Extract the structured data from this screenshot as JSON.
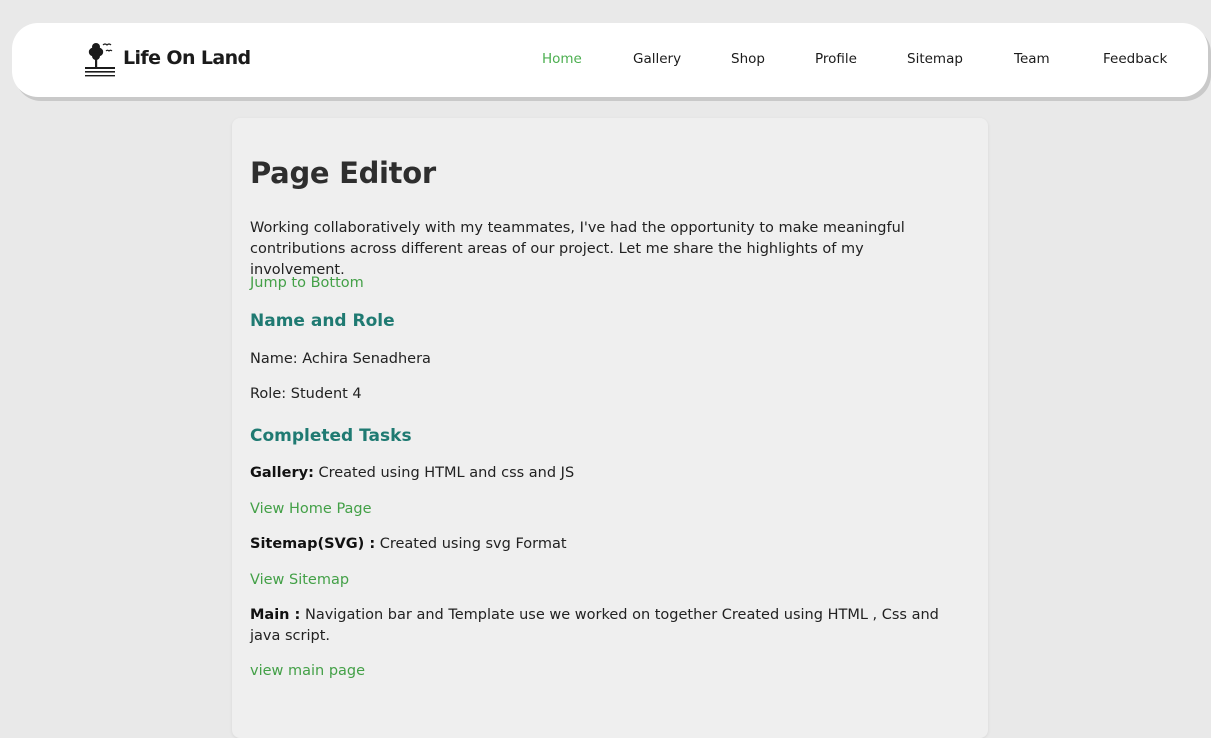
{
  "header": {
    "brand": "Life On Land",
    "nav": [
      "Home",
      "Gallery",
      "Shop",
      "Profile",
      "Sitemap",
      "Team",
      "Feedback"
    ],
    "active": "Home"
  },
  "main": {
    "title": "Page Editor",
    "intro": "Working collaboratively with my teammates, I've had the opportunity to make meaningful contributions across different areas of our project. Let me share the highlights of my involvement.",
    "jump_link": "Jump to Bottom",
    "section_name_role": "Name and Role",
    "name_line": "Name: Achira Senadhera",
    "role_line": "Role: Student 4",
    "section_tasks": "Completed Tasks",
    "tasks": [
      {
        "label": "Gallery:",
        "desc": " Created using HTML and css and JS",
        "link": "View Home Page"
      },
      {
        "label": "Sitemap(SVG) :",
        "desc": " Created using svg Format",
        "link": "View Sitemap"
      },
      {
        "label": "Main :",
        "desc": " Navigation bar and Template use we worked on together Created using HTML , Css and java script.",
        "link": "view main page"
      }
    ]
  },
  "colors": {
    "accent_green": "#43a047",
    "active_nav": "#4caf50",
    "heading_teal": "#1f7a72"
  }
}
